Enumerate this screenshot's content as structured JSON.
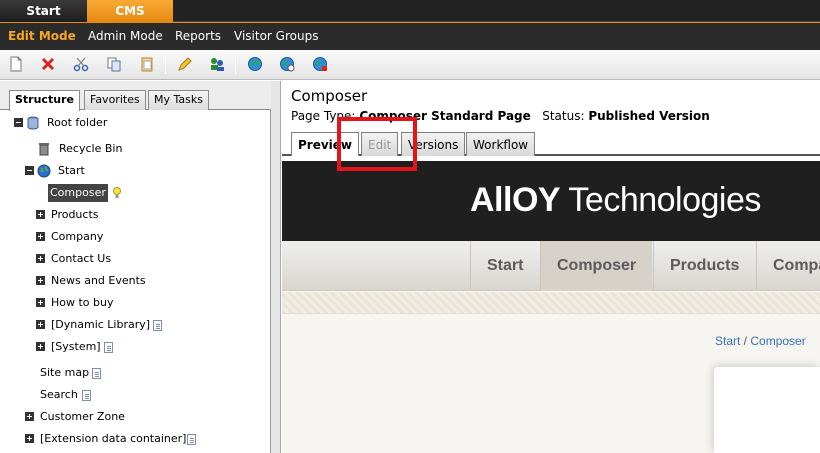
{
  "top_tabs": {
    "start": "Start",
    "cms": "CMS"
  },
  "modes": {
    "edit": "Edit Mode",
    "admin": "Admin Mode",
    "reports": "Reports",
    "visitor": "Visitor Groups"
  },
  "toolbar": {
    "icons": [
      "new-page-icon",
      "delete-icon",
      "cut-icon",
      "copy-icon",
      "paste-icon",
      "edit-icon",
      "users-icon",
      "globe-icon",
      "globe-view-icon",
      "globe-edit-icon"
    ]
  },
  "left_tabs": {
    "structure": "Structure",
    "favorites": "Favorites",
    "mytasks": "My Tasks"
  },
  "tree": {
    "root": "Root folder",
    "recycle": "Recycle Bin",
    "start": "Start",
    "composer": "Composer",
    "products": "Products",
    "company": "Company",
    "contact": "Contact Us",
    "news": "News and Events",
    "howtobuy": "How to buy",
    "dynlib": "[Dynamic Library]",
    "system": "[System]",
    "sitemap": "Site map",
    "search": "Search",
    "customer": "Customer Zone",
    "extension": "[Extension data container]"
  },
  "content": {
    "title": "Composer",
    "page_type_label": "Page Type:",
    "page_type_value": "Composer Standard Page",
    "status_label": "Status:",
    "status_value": "Published Version",
    "tabs": {
      "preview": "Preview",
      "edit": "Edit",
      "versions": "Versions",
      "workflow": "Workflow"
    }
  },
  "site": {
    "logo_bold": "AllOY",
    "logo_rest": " Technologies",
    "nav": {
      "start": "Start",
      "composer": "Composer",
      "products": "Products",
      "company": "Compa"
    },
    "crumb_start": "Start",
    "crumb_sep": " / ",
    "crumb_composer": "Composer"
  },
  "colors": {
    "accent": "#e68a10",
    "highlight": "#e5141b",
    "link": "#3a6fb8"
  }
}
